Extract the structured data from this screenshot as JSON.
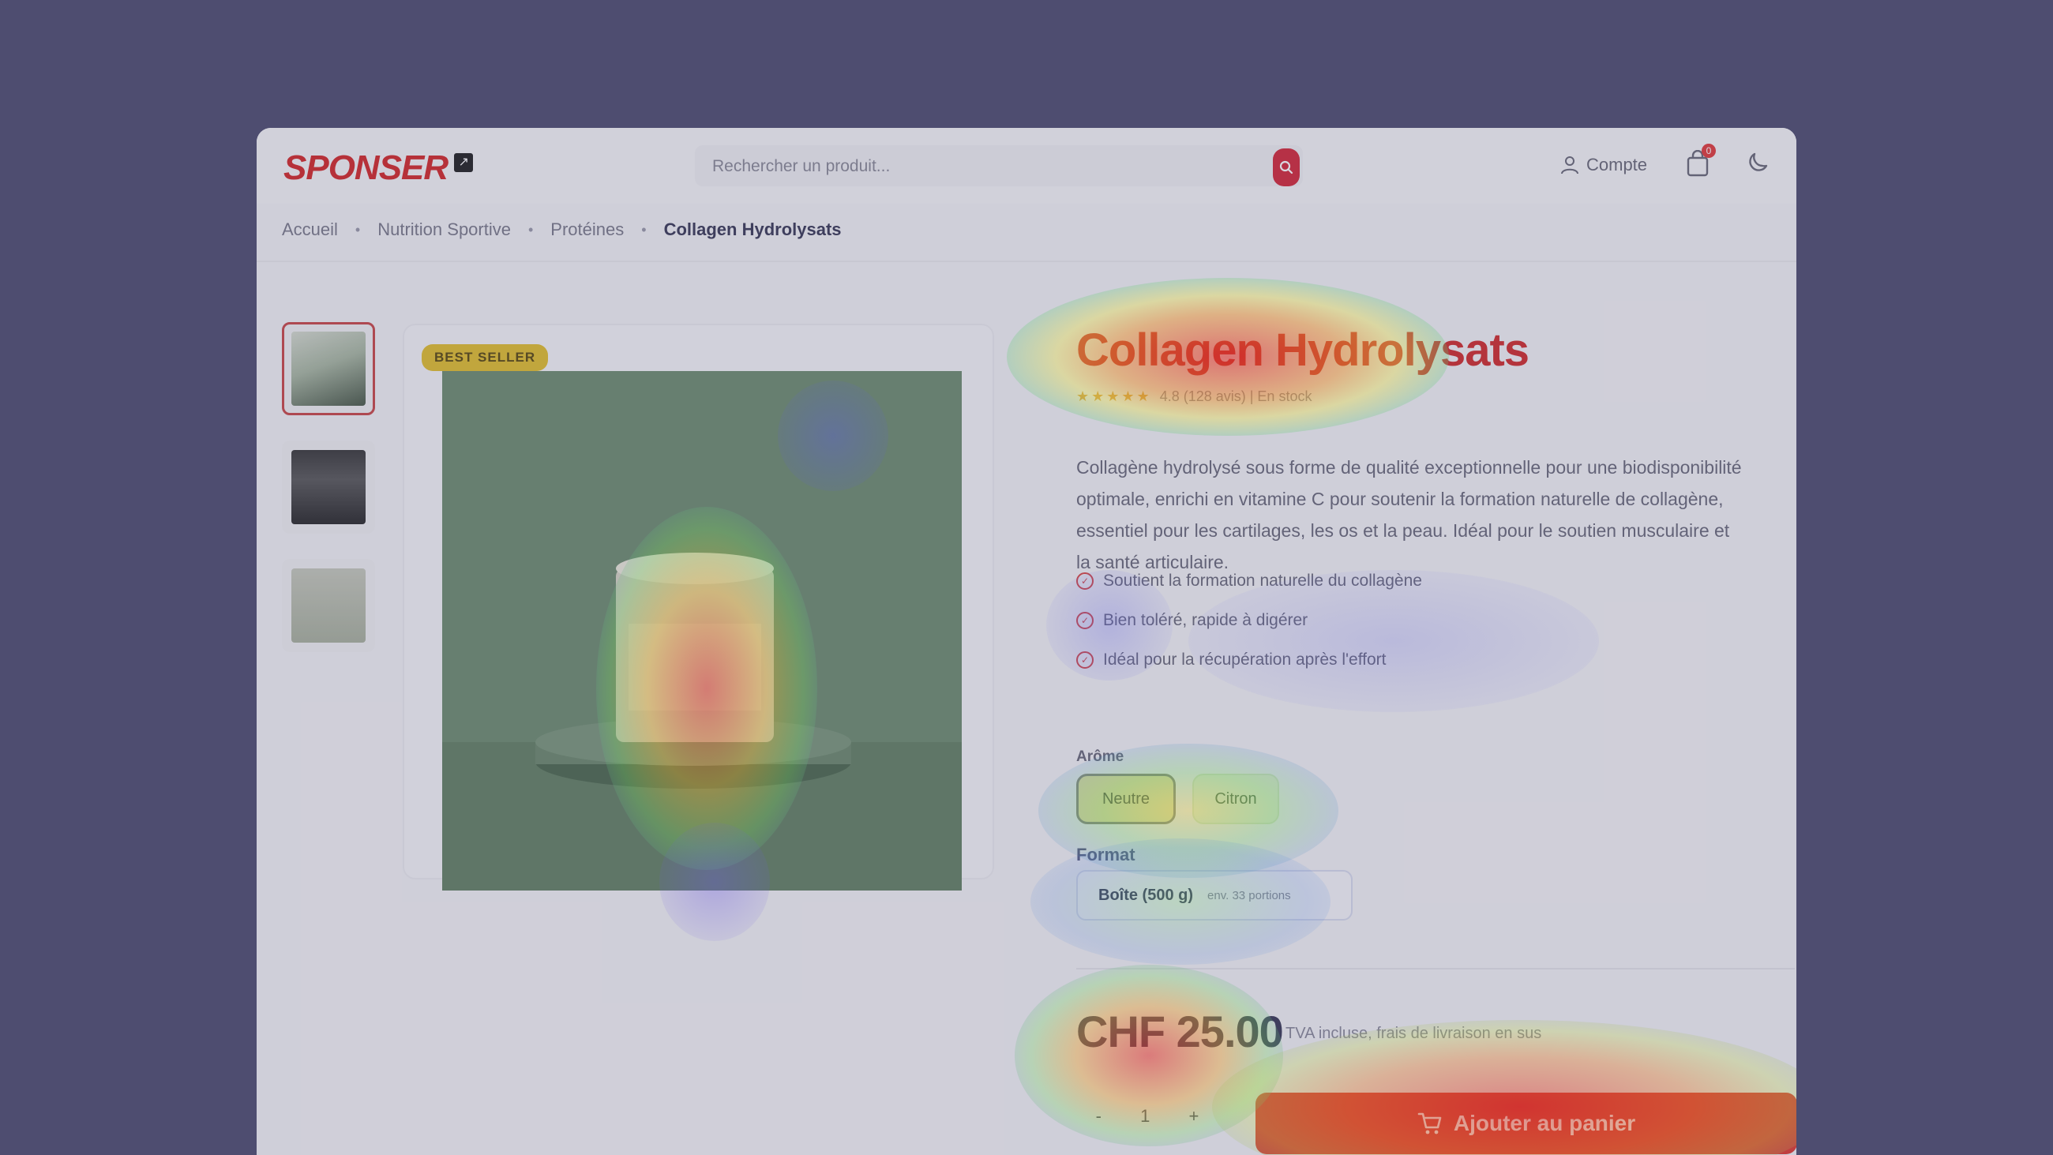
{
  "header": {
    "logo": "SPONSER",
    "logo_badge": "↗",
    "search_placeholder": "Rechercher un produit...",
    "account_label": "Compte",
    "cart_count": "0"
  },
  "breadcrumb": {
    "items": [
      "Accueil",
      "Nutrition Sportive",
      "Protéines",
      "Collagen Hydrolysats"
    ]
  },
  "gallery": {
    "badge": "BEST SELLER"
  },
  "product": {
    "title": "Collagen Hydrolysats",
    "rating_text": "★★★★★",
    "reviews": "4.8 (128 avis) | En stock",
    "description": "Collagène hydrolysé sous forme de qualité exceptionnelle pour une biodisponibilité optimale, enrichi en vitamine C pour soutenir la formation naturelle de collagène, essentiel pour les cartilages, les os et la peau. Idéal pour le soutien musculaire et la santé articulaire.",
    "bullets": [
      "Soutient la formation naturelle du collagène",
      "Bien toléré, rapide à digérer",
      "Idéal pour la récupération après l'effort"
    ],
    "option_label": "Arôme",
    "options": [
      "Neutre",
      "Citron"
    ],
    "size_label": "Format",
    "size_main": "Boîte (500 g)",
    "size_sub": "env. 33 portions",
    "price": "CHF 25.00",
    "price_note": "TVA incluse, frais de livraison en sus",
    "quantity": "1",
    "qty_minus": "-",
    "qty_plus": "+",
    "add_to_cart": "Ajouter au panier"
  },
  "colors": {
    "brand": "#d42a2a",
    "background": "#4e4d70",
    "cta": "#e03a32"
  }
}
